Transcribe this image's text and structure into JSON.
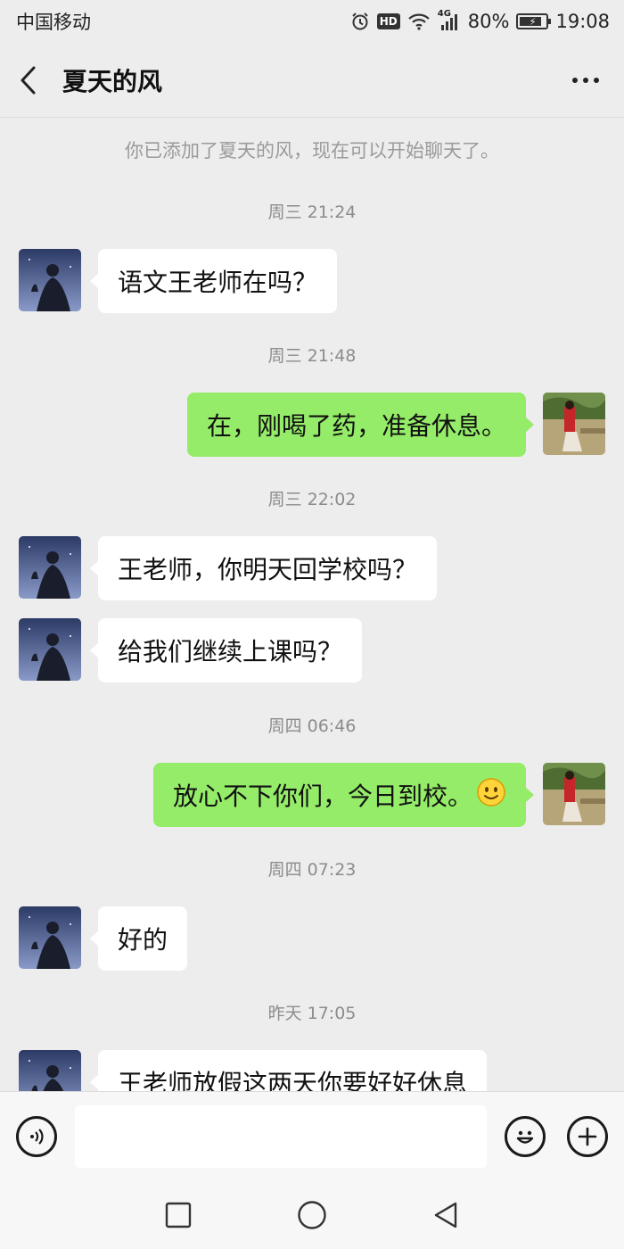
{
  "status_bar": {
    "carrier": "中国移动",
    "network": "4G",
    "hd_badge": "HD",
    "battery_percent": "80%",
    "battery_level": 0.8,
    "time": "19:08",
    "icons": [
      "alarm-icon",
      "hd-icon",
      "wifi-icon",
      "signal-icon",
      "battery-charging-icon"
    ]
  },
  "header": {
    "contact_name": "夏天的风",
    "back_icon": "chevron-left-icon",
    "more_icon": "more-dots-icon"
  },
  "chat": {
    "system_notice": "你已添加了夏天的风，现在可以开始聊天了。",
    "timestamps": [
      "周三 21:24",
      "周三 21:48",
      "周三 22:02",
      "周四 06:46",
      "周四 07:23",
      "昨天 17:05"
    ],
    "messages": [
      {
        "from": "them",
        "text": "语文王老师在吗？"
      },
      {
        "from": "me",
        "text": "在，刚喝了药，准备休息。"
      },
      {
        "from": "them",
        "text": "王老师，你明天回学校吗？"
      },
      {
        "from": "them",
        "text": "给我们继续上课吗？"
      },
      {
        "from": "me",
        "text": "放心不下你们，今日到校。",
        "emoji": "smile-emoji"
      },
      {
        "from": "them",
        "text": "好的"
      },
      {
        "from": "them",
        "text": "王老师放假这两天你要好好休息"
      }
    ]
  },
  "input_bar": {
    "voice_icon": "voice-icon",
    "text_value": "",
    "emoji_icon": "emoji-icon",
    "plus_icon": "plus-icon"
  },
  "system_nav": {
    "keys": [
      "recent-apps-icon",
      "home-icon",
      "back-icon"
    ]
  },
  "colors": {
    "background": "#ededed",
    "outgoing_bubble": "#95ec69",
    "incoming_bubble": "#ffffff",
    "timestamp_text": "#8c8c8c"
  }
}
